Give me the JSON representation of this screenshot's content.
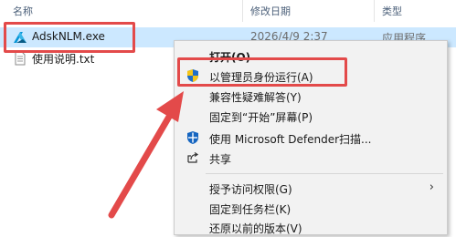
{
  "columns": {
    "name": "名称",
    "date": "修改日期",
    "type": "类型"
  },
  "files": [
    {
      "name": "AdskNLM.exe",
      "date": "2026/4/9 2:37",
      "type": "应用程序"
    },
    {
      "name": "使用说明.txt"
    }
  ],
  "menu": {
    "items": [
      {
        "label": "打开(O)"
      },
      {
        "label": "以管理员身份运行(A)"
      },
      {
        "label": "兼容性疑难解答(Y)"
      },
      {
        "label": "固定到“开始”屏幕(P)"
      },
      {
        "label": "使用 Microsoft Defender扫描..."
      },
      {
        "label": "共享"
      },
      {
        "label": "授予访问权限(G)"
      },
      {
        "label": "固定到任务栏(K)"
      },
      {
        "label": "还原以前的版本(V)"
      }
    ],
    "submenu_arrow": "›"
  },
  "colors": {
    "highlight": "#e34a4a",
    "selection": "#cce8ff",
    "menu_bg": "#f2f2f2"
  },
  "icons": {
    "exe": "autodesk-logo-icon",
    "txt": "text-document-icon",
    "admin": "uac-shield-icon",
    "defender": "defender-shield-icon",
    "share": "share-icon"
  }
}
